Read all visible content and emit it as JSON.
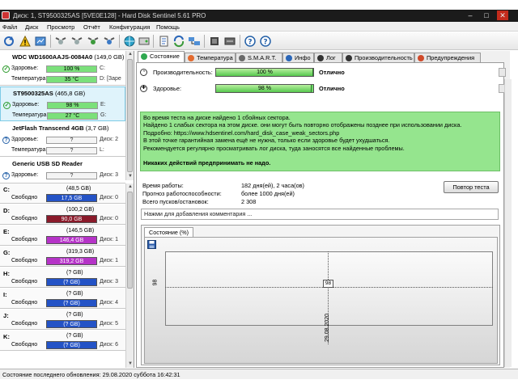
{
  "window": {
    "title": "Диск: 1, ST9500325AS [5VE0E128]  -  Hard Disk Sentinel 5.61 PRO",
    "controls": [
      "–",
      "□",
      "✕"
    ]
  },
  "menu": [
    "Файл",
    "Диск",
    "Просмотр",
    "Отчёт",
    "Конфигурация",
    "Помощь"
  ],
  "toolbar": {
    "icons": [
      "refresh-icon",
      "warning-icon",
      "report-icon",
      "satellite-icon",
      "satellite-icon",
      "satellite-icon",
      "satellite-icon",
      "globe-icon",
      "disk-icon",
      "document-icon",
      "sync-icon",
      "network-icon",
      "chip-icon",
      "settings-icon",
      "help-icon",
      "info-icon"
    ]
  },
  "disks": [
    {
      "name": "WDC WD1600AAJS-0084A0",
      "size": "(149,0 GB)",
      "health_label": "Здоровье:",
      "health": "100 %",
      "health_drive": "C:",
      "temp_label": "Температура:",
      "temp": "35 °C",
      "temp_drive": "D: [Заре"
    },
    {
      "name": "ST9500325AS",
      "size": "(465,8 GB)",
      "health_label": "Здоровье:",
      "health": "98 %",
      "health_drive": "E:",
      "temp_label": "Температура:",
      "temp": "27 °C",
      "temp_drive": "G:"
    },
    {
      "name": "JetFlash Transcend 4GB",
      "size": "(3,7 GB)",
      "health_label": "Здоровье:",
      "health": "?",
      "health_drive": "Диск: 2",
      "temp_label": "Температура:",
      "temp": "?",
      "temp_drive": "L:"
    },
    {
      "name": "Generic  USB  SD Reader",
      "size": "",
      "health_label": "Здоровье:",
      "health": "?",
      "health_drive": "Диск: 3",
      "temp_label": "",
      "temp": "",
      "temp_drive": ""
    }
  ],
  "partitions": [
    {
      "letter": "C:",
      "size": "(48,5 GB)",
      "free_label": "Свободно",
      "free": "17,5 GB",
      "color": "#2453c6",
      "disk": "Диск: 0"
    },
    {
      "letter": "D:",
      "size": "(100,2 GB)",
      "free_label": "Свободно",
      "free": "90,0 GB",
      "color": "#8a1a2a",
      "disk": "Диск: 0"
    },
    {
      "letter": "E:",
      "size": "(146,5 GB)",
      "free_label": "Свободно",
      "free": "146,4 GB",
      "color": "#b533c7",
      "disk": "Диск: 1"
    },
    {
      "letter": "G:",
      "size": "(319,3 GB)",
      "free_label": "Свободно",
      "free": "319,2 GB",
      "color": "#b533c7",
      "disk": "Диск: 1"
    },
    {
      "letter": "H:",
      "size": "(? GB)",
      "free_label": "Свободно",
      "free": "(? GB)",
      "color": "#2453c6",
      "disk": "Диск: 3"
    },
    {
      "letter": "I:",
      "size": "(? GB)",
      "free_label": "Свободно",
      "free": "(? GB)",
      "color": "#2453c6",
      "disk": "Диск: 4"
    },
    {
      "letter": "J:",
      "size": "(? GB)",
      "free_label": "Свободно",
      "free": "(? GB)",
      "color": "#2453c6",
      "disk": "Диск: 5"
    },
    {
      "letter": "K:",
      "size": "(? GB)",
      "free_label": "Свободно",
      "free": "(? GB)",
      "color": "#2453c6",
      "disk": "Диск: 6"
    }
  ],
  "tabs": [
    {
      "label": "Состояние",
      "icon": "#2fa84f"
    },
    {
      "label": "Температура",
      "icon": "#e36a2e"
    },
    {
      "label": "S.M.A.R.T.",
      "icon": "#6a6a6a"
    },
    {
      "label": "Инфо",
      "icon": "#2a66b8"
    },
    {
      "label": "Лог",
      "icon": "#333333"
    },
    {
      "label": "Производительность",
      "icon": "#333333"
    },
    {
      "label": "Предупреждения",
      "icon": "#d04a2a"
    }
  ],
  "status": {
    "performance_label": "Производительность:",
    "performance_value": "100 %",
    "performance_fraction": 1.0,
    "performance_result": "Отлично",
    "health_label": "Здоровье:",
    "health_value": "98 %",
    "health_fraction": 0.98,
    "health_result": "Отлично"
  },
  "message": {
    "lines": [
      "Во время теста на диске найдено 1 сбойных сектора.",
      "Найдено 1 слабых сектора на этом диске. они могут быть повторно отображены позднее при использовании диска.",
      "Подробно: https://www.hdsentinel.com/hard_disk_case_weak_sectors.php",
      "В этой точке гарантийная замена ещё не нужна, только если здоровье будет ухудшаться.",
      "Рекомендуется регулярно просматривать лог диска, туда заносятся все найденные проблемы."
    ],
    "conclusion": "Никаких действий предпринимать не надо."
  },
  "info": {
    "uptime_label": "Время работы:",
    "uptime": "182 дня(ей), 2 часа(ов)",
    "forecast_label": "Прогноз работоспособности:",
    "forecast": "более 1000 дня(ей)",
    "starts_label": "Всего пусков/остановок:",
    "starts": "2 308",
    "retest_button": "Повтор теста"
  },
  "comment_placeholder": "Нажми для добавления комментария ...",
  "chart_tab": "Состояние (%)",
  "chart_data": {
    "type": "line",
    "x": [
      "29.08.2020"
    ],
    "series": [
      {
        "values": [
          98
        ]
      }
    ],
    "y_tick": "98",
    "point_label": "98",
    "x_tick": "29.08.2020"
  },
  "statusbar": "Состояние последнего обновления: 29.08.2020 суббота 16:42:31"
}
